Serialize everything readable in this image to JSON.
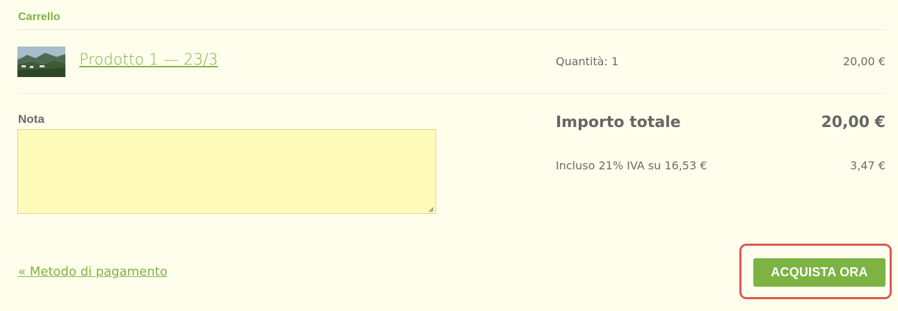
{
  "cart": {
    "title": "Carrello",
    "item": {
      "name": "Prodotto 1 — 23/3",
      "quantity_text": "Quantità: 1",
      "price": "20,00 €",
      "thumbnail_icon": "landscape-image"
    }
  },
  "note": {
    "label": "Nota",
    "value": "",
    "placeholder": ""
  },
  "summary": {
    "total_label": "Importo totale",
    "total_value": "20,00 €",
    "tax_label": "Incluso 21% IVA su 16,53 €",
    "tax_value": "3,47 €"
  },
  "actions": {
    "back_link": "« Metodo di pagamento",
    "buy_button": "ACQUISTA ORA"
  },
  "colors": {
    "background": "#fffeec",
    "accent": "#7cb342",
    "note_background": "#fffcbb",
    "highlight": "#d9594c"
  }
}
